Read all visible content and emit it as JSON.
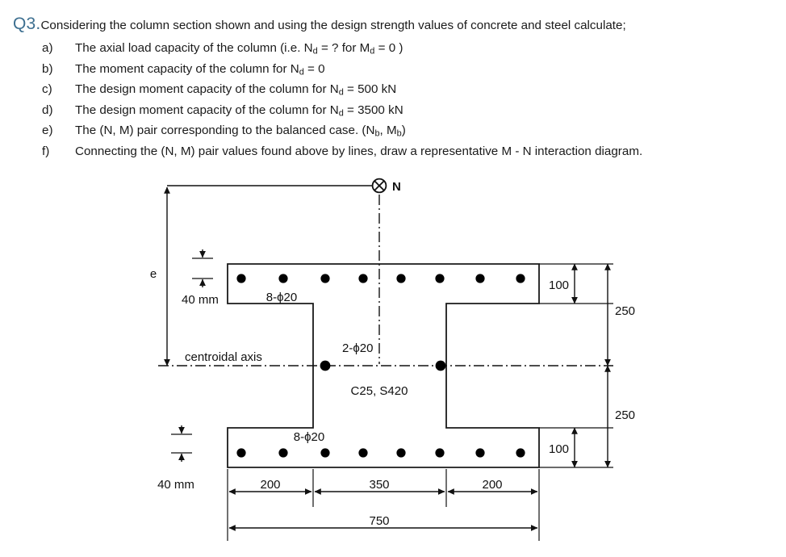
{
  "question": {
    "number": "Q3.",
    "intro": "Considering the column section shown and using the design strength values of concrete and steel calculate;",
    "number_color": "#3d6f90",
    "items": [
      {
        "marker": "a)",
        "text_pre": "The axial load capacity of the column (i.e. N",
        "sub1": "d",
        "text_mid": " = ? for M",
        "sub2": "d",
        "text_post": " = 0 )"
      },
      {
        "marker": "b)",
        "text_pre": "The moment capacity of the column for N",
        "sub1": "d",
        "text_mid": " = 0",
        "sub2": "",
        "text_post": ""
      },
      {
        "marker": "c)",
        "text_pre": "The design moment capacity of the column for N",
        "sub1": "d",
        "text_mid": " = 500 kN",
        "sub2": "",
        "text_post": ""
      },
      {
        "marker": "d)",
        "text_pre": "The design moment capacity of the column for N",
        "sub1": "d",
        "text_mid": " = 3500 kN",
        "sub2": "",
        "text_post": ""
      },
      {
        "marker": "e)",
        "text_pre": "The (N, M) pair corresponding to the balanced case. (N",
        "sub1": "b",
        "text_mid": ", M",
        "sub2": "b",
        "text_post": ")"
      },
      {
        "marker": "f)",
        "text_pre": "Connecting the (N, M) pair values found above by lines, draw a representative M - N interaction diagram.",
        "sub1": "",
        "text_mid": "",
        "sub2": "",
        "text_post": ""
      }
    ]
  },
  "figure": {
    "load_label": "N",
    "load_symbol": "circle-x",
    "eccentricity_label": "e",
    "centroidal_axis_label": "centroidal axis",
    "material_label": "C25, S420",
    "top_rebar_label": "8-ϕ20",
    "bottom_rebar_label": "8-ϕ20",
    "web_rebar_label": "2-ϕ20",
    "cover_top_label": "40 mm",
    "cover_bottom_label": "40 mm",
    "flange_thickness_top": "100",
    "flange_thickness_bottom": "100",
    "half_depth_top": "250",
    "half_depth_bottom": "250",
    "width_left": "200",
    "width_web": "350",
    "width_right": "200",
    "width_total": "750",
    "top_bar_count": 8,
    "bottom_bar_count": 8,
    "web_bar_count": 2
  }
}
